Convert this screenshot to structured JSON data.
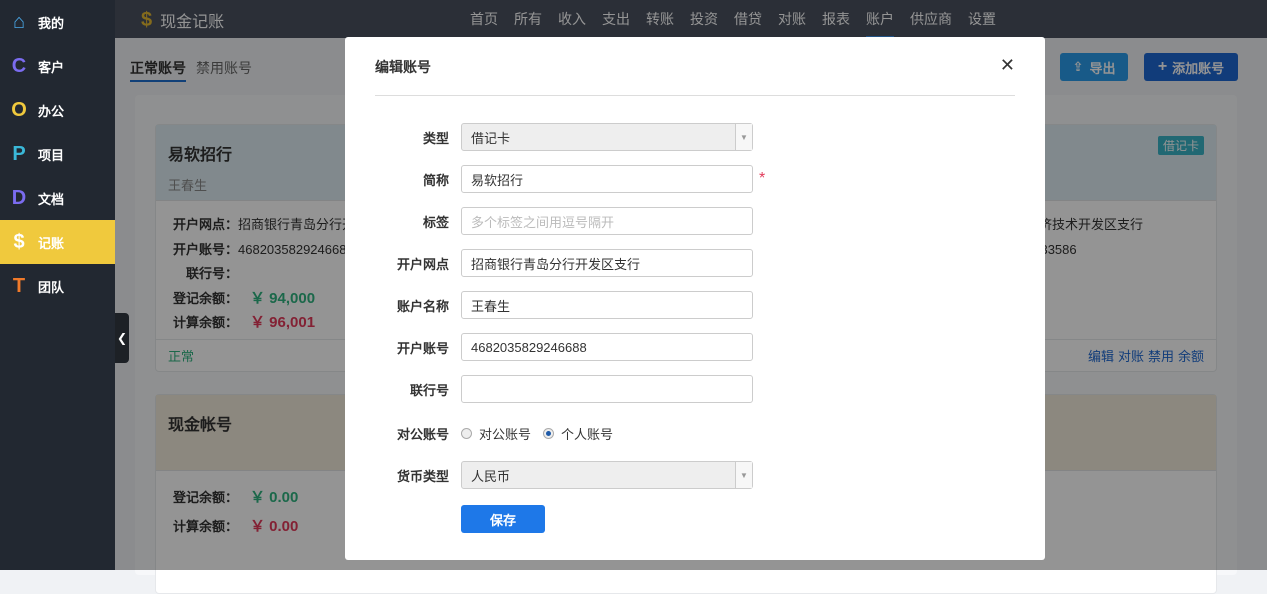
{
  "sidebar": {
    "items": [
      {
        "icon": "home-icon",
        "glyph": "⌂",
        "color": "#4aa8e8",
        "label": "我的"
      },
      {
        "icon": "letter-c-icon",
        "glyph": "C",
        "color": "#7b6cf0",
        "label": "客户"
      },
      {
        "icon": "letter-o-icon",
        "glyph": "O",
        "color": "#f0c93d",
        "label": "办公"
      },
      {
        "icon": "letter-p-icon",
        "glyph": "P",
        "color": "#3ab8d8",
        "label": "项目"
      },
      {
        "icon": "letter-d-icon",
        "glyph": "D",
        "color": "#7b6cf0",
        "label": "文档"
      },
      {
        "icon": "dollar-icon",
        "glyph": "$",
        "color": "#ffffff",
        "label": "记账"
      },
      {
        "icon": "letter-t-icon",
        "glyph": "T",
        "color": "#f07a2a",
        "label": "团队"
      }
    ]
  },
  "header": {
    "app_title": "现金记账",
    "nav": [
      "首页",
      "所有",
      "收入",
      "支出",
      "转账",
      "投资",
      "借贷",
      "对账",
      "报表",
      "账户",
      "供应商",
      "设置"
    ]
  },
  "tabs": {
    "normal": "正常账号",
    "disabled": "禁用账号"
  },
  "toolbar": {
    "export": "导出",
    "add": "添加账号"
  },
  "card1": {
    "title": "易软招行",
    "owner": "王春生",
    "badge": "借记卡",
    "branch_label": "开户网点：",
    "branch": "招商银行青岛分行开",
    "account_label": "开户账号：",
    "account": "4682035829246688",
    "bank_no_label": "联行号：",
    "reg_label": "登记余额：",
    "reg": "￥ 94,000",
    "calc_label": "计算余额：",
    "calc": "￥ 96,001",
    "status": "正常",
    "right_branch": "经济技术开发区支行",
    "right_account": "0133586",
    "actions": [
      "编辑",
      "对账",
      "禁用",
      "余额"
    ]
  },
  "card2": {
    "title": "现金帐号",
    "reg_label": "登记余额：",
    "reg": "￥ 0.00",
    "calc_label": "计算余额：",
    "calc": "￥ 0.00"
  },
  "modal": {
    "title": "编辑账号",
    "type_label": "类型",
    "type": "借记卡",
    "name_label": "简称",
    "name": "易软招行",
    "tags_label": "标签",
    "tags_placeholder": "多个标签之间用逗号隔开",
    "branch_label": "开户网点",
    "branch": "招商银行青岛分行开发区支行",
    "holder_label": "账户名称",
    "holder": "王春生",
    "account_label": "开户账号",
    "account": "4682035829246688",
    "bank_no_label": "联行号",
    "bank_no": "",
    "public_label": "对公账号",
    "opt_public": "对公账号",
    "opt_personal": "个人账号",
    "currency_label": "货币类型",
    "currency": "人民币",
    "save": "保存"
  }
}
